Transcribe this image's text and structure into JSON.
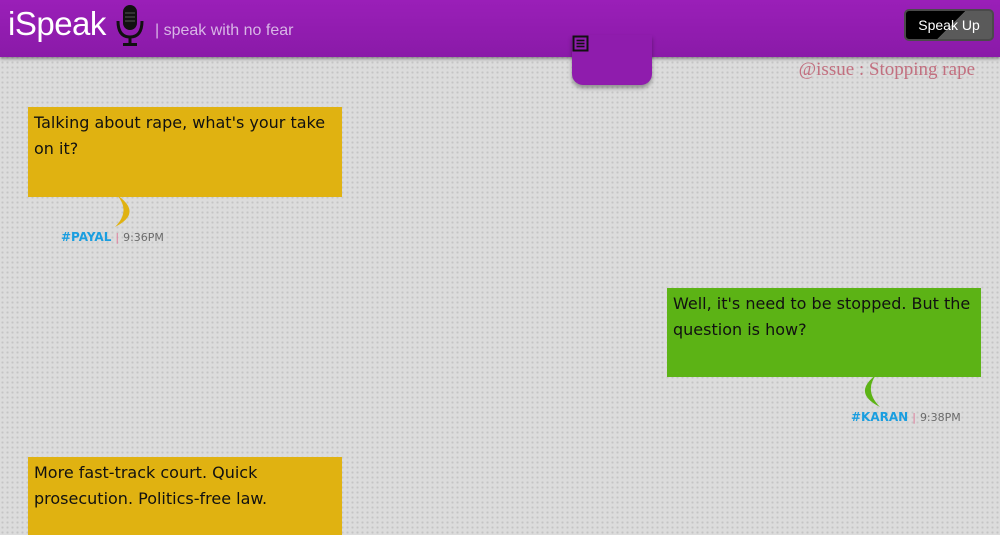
{
  "header": {
    "logo": "iSpeak",
    "tagline": "| speak with no fear",
    "speak_up_label": "Speak Up"
  },
  "issue": "@issue : Stopping rape",
  "colors": {
    "header": "#9a1fb8",
    "left_bubble": "#e0b211",
    "right_bubble": "#5cb315",
    "username": "#1a9ee0",
    "issue_text": "#c26f7f"
  },
  "icons": {
    "mic": "microphone-icon",
    "doc": "document-icon"
  },
  "messages": [
    {
      "text": "Talking about rape, what's your take on it?",
      "user": "#PAYAL",
      "time": "9:36PM",
      "side": "left"
    },
    {
      "text": "Well, it's need to be stopped. But the question is how?",
      "user": "#KARAN",
      "time": "9:38PM",
      "side": "right"
    },
    {
      "text": "More fast-track court. Quick prosecution. Politics-free law.",
      "user": "",
      "time": "",
      "side": "left"
    }
  ]
}
